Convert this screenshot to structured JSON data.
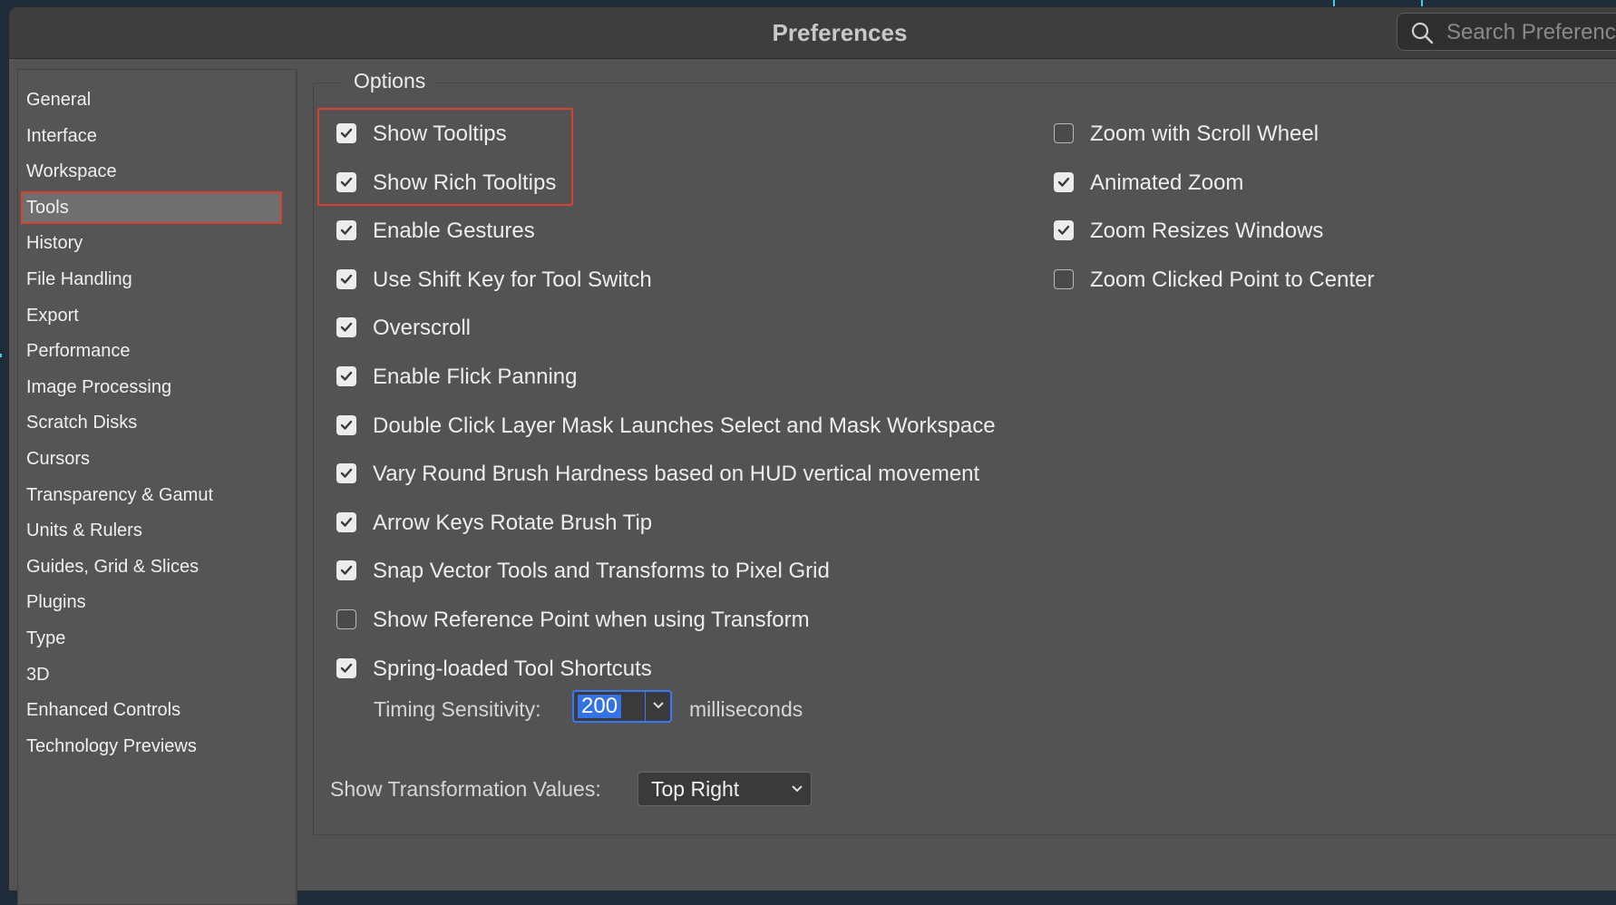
{
  "window": {
    "title": "Preferences"
  },
  "search": {
    "placeholder": "Search Preferences"
  },
  "sidebar": {
    "items": [
      {
        "label": "General"
      },
      {
        "label": "Interface"
      },
      {
        "label": "Workspace"
      },
      {
        "label": "Tools",
        "active": true
      },
      {
        "label": "History"
      },
      {
        "label": "File Handling"
      },
      {
        "label": "Export"
      },
      {
        "label": "Performance"
      },
      {
        "label": "Image Processing"
      },
      {
        "label": "Scratch Disks"
      },
      {
        "label": "Cursors"
      },
      {
        "label": "Transparency & Gamut"
      },
      {
        "label": "Units & Rulers"
      },
      {
        "label": "Guides, Grid & Slices"
      },
      {
        "label": "Plugins"
      },
      {
        "label": "Type"
      },
      {
        "label": "3D"
      },
      {
        "label": "Enhanced Controls"
      },
      {
        "label": "Technology Previews"
      }
    ]
  },
  "options": {
    "legend": "Options",
    "left": [
      {
        "label": "Show Tooltips",
        "checked": true
      },
      {
        "label": "Show Rich Tooltips",
        "checked": true
      },
      {
        "label": "Enable Gestures",
        "checked": true
      },
      {
        "label": "Use Shift Key for Tool Switch",
        "checked": true
      },
      {
        "label": "Overscroll",
        "checked": true
      },
      {
        "label": "Enable Flick Panning",
        "checked": true
      },
      {
        "label": "Double Click Layer Mask Launches Select and Mask Workspace",
        "checked": true
      },
      {
        "label": "Vary Round Brush Hardness based on HUD vertical movement",
        "checked": true
      },
      {
        "label": "Arrow Keys Rotate Brush Tip",
        "checked": true
      },
      {
        "label": "Snap Vector Tools and Transforms to Pixel Grid",
        "checked": true
      },
      {
        "label": "Show Reference Point when using Transform",
        "checked": false
      },
      {
        "label": "Spring-loaded Tool Shortcuts",
        "checked": true
      }
    ],
    "right": [
      {
        "label": "Zoom with Scroll Wheel",
        "checked": false
      },
      {
        "label": "Animated Zoom",
        "checked": true
      },
      {
        "label": "Zoom Resizes Windows",
        "checked": true
      },
      {
        "label": "Zoom Clicked Point to Center",
        "checked": false
      }
    ],
    "timing": {
      "label": "Timing Sensitivity:",
      "value": "200",
      "unit": "milliseconds"
    },
    "transform_values": {
      "label": "Show Transformation Values:",
      "value": "Top Right"
    }
  },
  "colors": {
    "highlight": "#d9412f",
    "focus": "#3b78ff"
  }
}
